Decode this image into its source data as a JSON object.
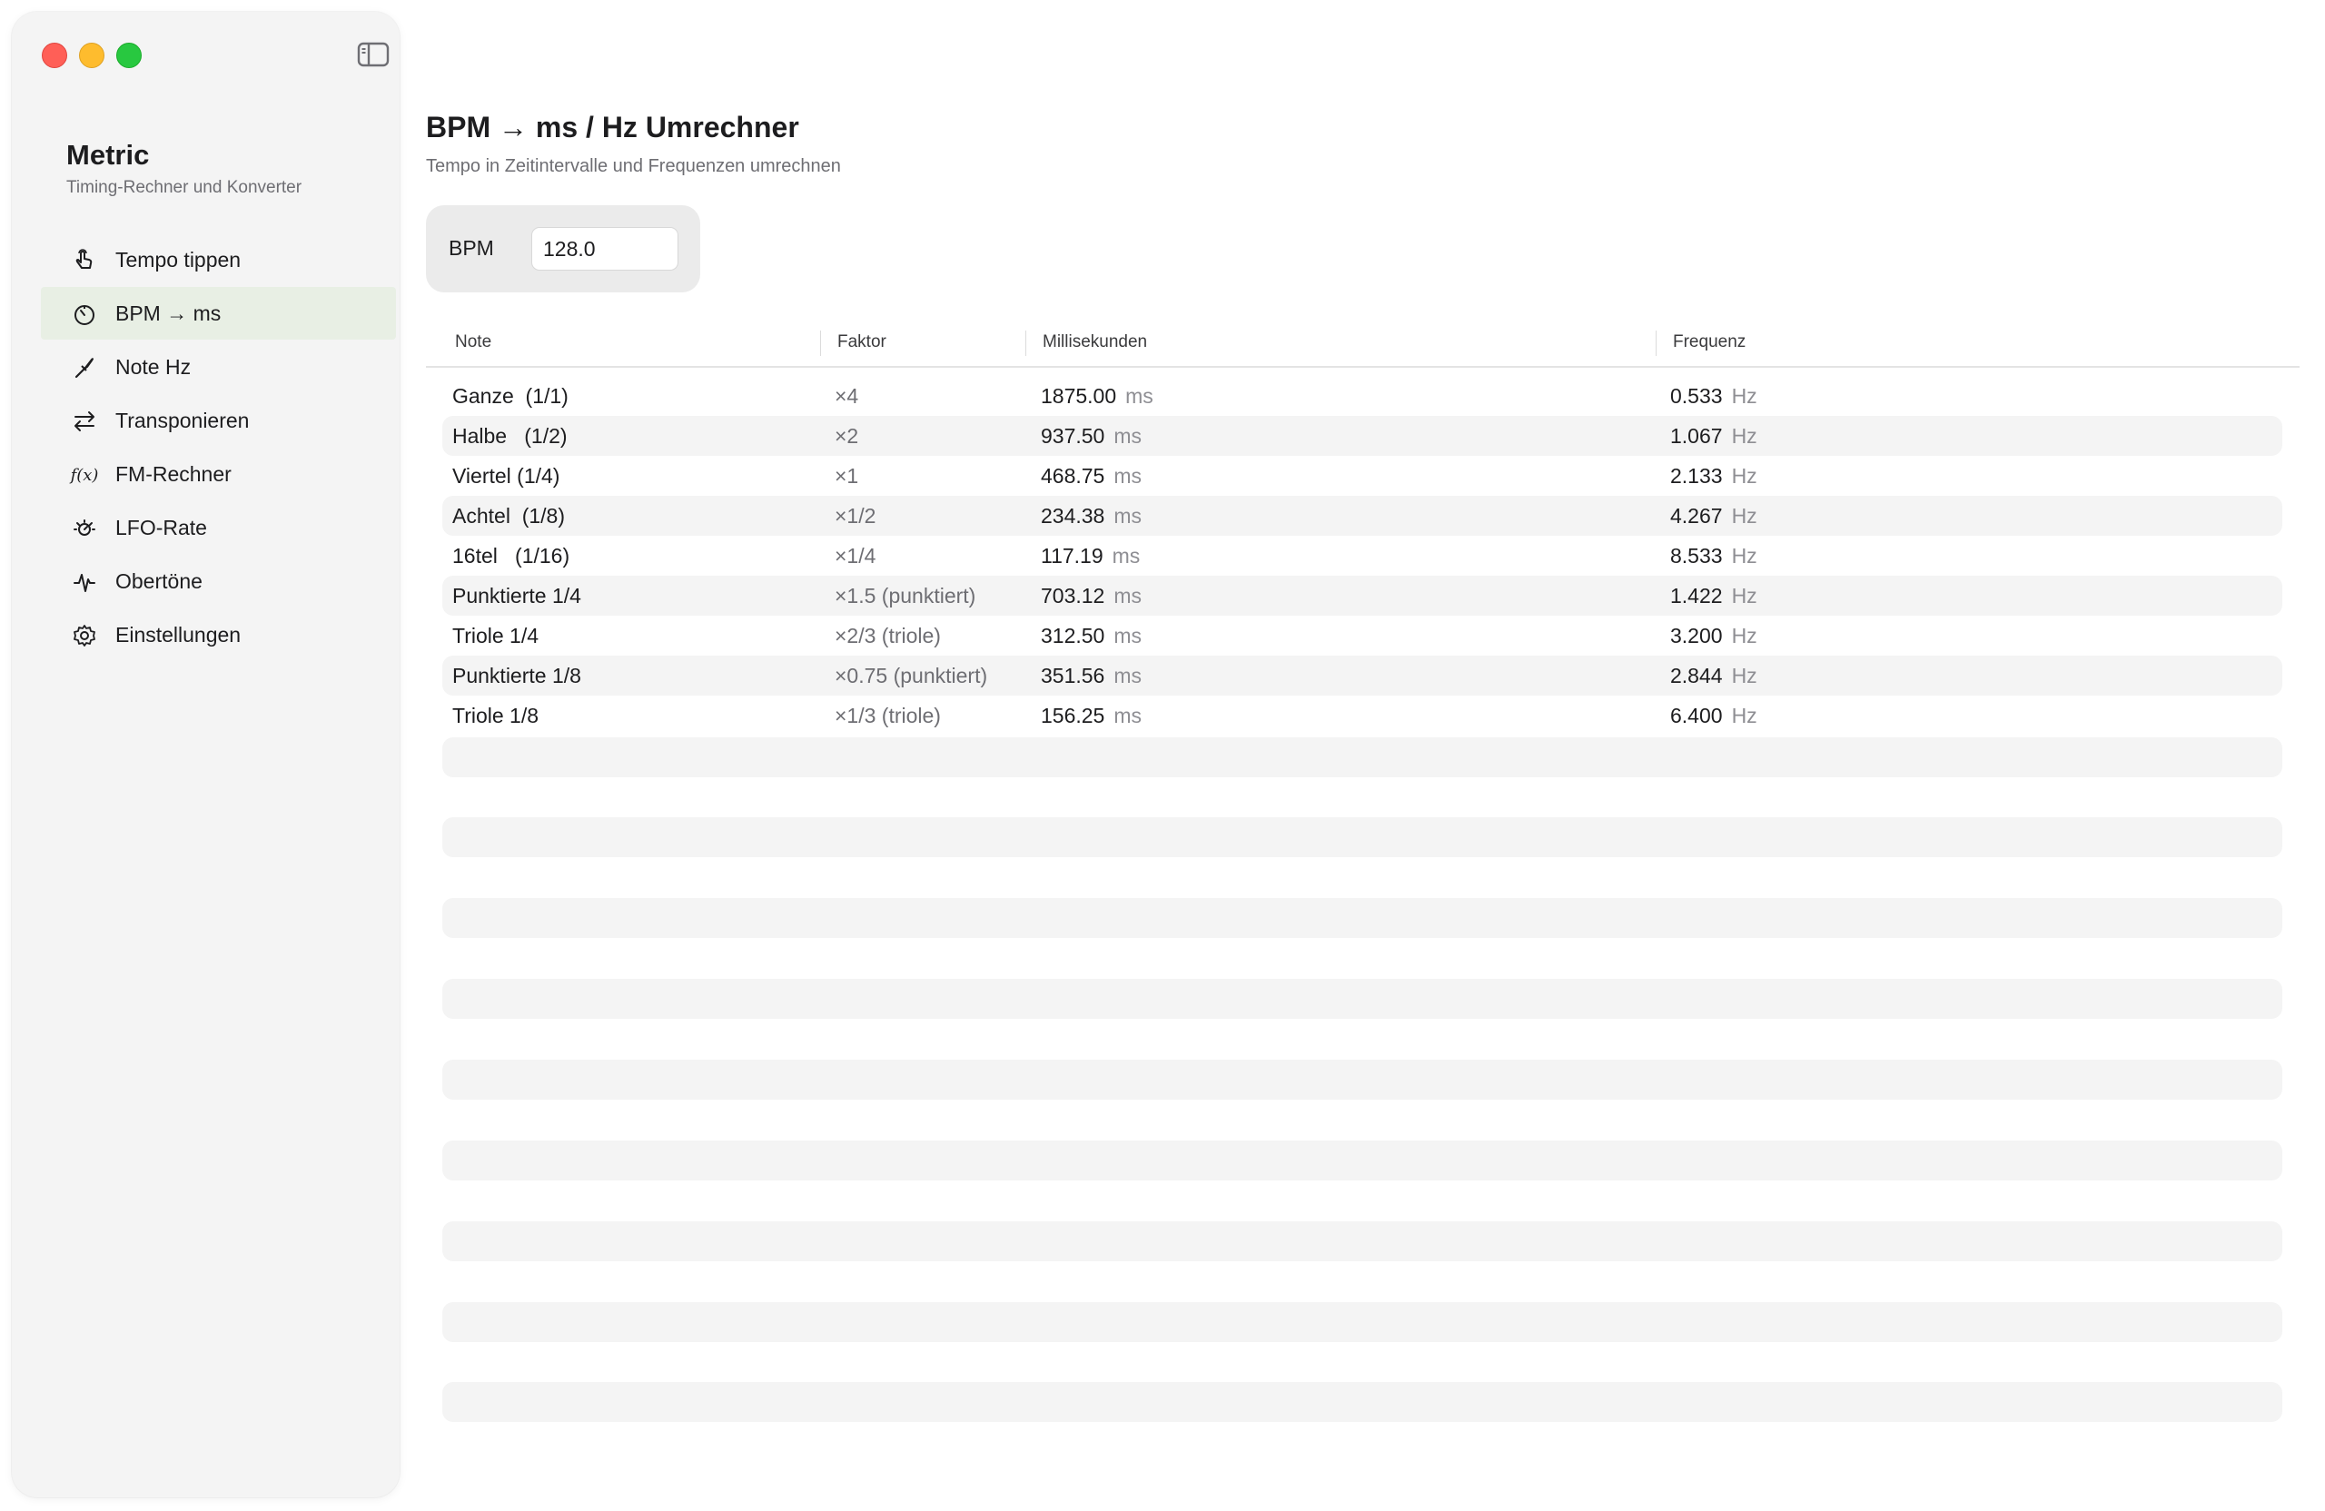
{
  "app": {
    "title": "Metric",
    "subtitle": "Timing-Rechner und Konverter"
  },
  "sidebar": {
    "items": [
      {
        "label": "Tempo tippen",
        "icon": "hand-tap-icon"
      },
      {
        "label": "BPM → ms",
        "icon": "timer-icon",
        "active": true
      },
      {
        "label": "Note Hz",
        "icon": "tuning-fork-icon"
      },
      {
        "label": "Transponieren",
        "icon": "arrows-swap-icon"
      },
      {
        "label": "FM-Rechner",
        "icon": "function-icon",
        "icon_text": "f(x)"
      },
      {
        "label": "LFO-Rate",
        "icon": "sun-dial-icon"
      },
      {
        "label": "Obertöne",
        "icon": "waveform-icon"
      },
      {
        "label": "Einstellungen",
        "icon": "gear-icon"
      }
    ]
  },
  "main": {
    "title": "BPM → ms / Hz Umrechner",
    "subtitle": "Tempo in Zeitintervalle und Frequenzen umrechnen",
    "bpm": {
      "label": "BPM",
      "value": "128.0"
    },
    "table": {
      "headers": [
        "Note",
        "Faktor",
        "Millisekunden",
        "Frequenz"
      ],
      "ms_unit": "ms",
      "hz_unit": "Hz",
      "rows": [
        {
          "note": "Ganze  (1/1)",
          "factor": "×4",
          "ms": "1875.00",
          "hz": "0.533"
        },
        {
          "note": "Halbe   (1/2)",
          "factor": "×2",
          "ms": "937.50",
          "hz": "1.067"
        },
        {
          "note": "Viertel (1/4)",
          "factor": "×1",
          "ms": "468.75",
          "hz": "2.133"
        },
        {
          "note": "Achtel  (1/8)",
          "factor": "×1/2",
          "ms": "234.38",
          "hz": "4.267"
        },
        {
          "note": "16tel   (1/16)",
          "factor": "×1/4",
          "ms": "117.19",
          "hz": "8.533"
        },
        {
          "note": "Punktierte 1/4",
          "factor": "×1.5 (punktiert)",
          "ms": "703.12",
          "hz": "1.422"
        },
        {
          "note": "Triole 1/4",
          "factor": "×2/3 (triole)",
          "ms": "312.50",
          "hz": "3.200"
        },
        {
          "note": "Punktierte 1/8",
          "factor": "×0.75 (punktiert)",
          "ms": "351.56",
          "hz": "2.844"
        },
        {
          "note": "Triole 1/8",
          "factor": "×1/3 (triole)",
          "ms": "156.25",
          "hz": "6.400"
        }
      ]
    }
  },
  "colors": {
    "close": "#ff5f57",
    "minimize": "#febc2e",
    "zoom": "#28c840",
    "active_nav": "#e8efe4",
    "alt_row": "#f4f4f4"
  }
}
